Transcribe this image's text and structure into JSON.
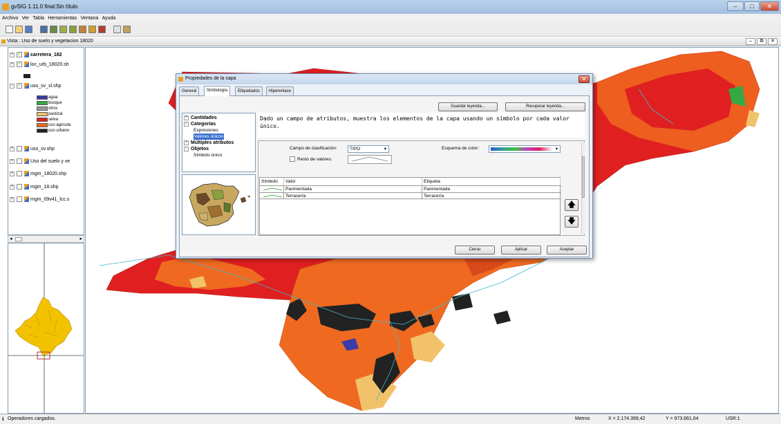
{
  "app": {
    "title": "gvSIG 1.11.0 final:Sin título",
    "win_minimize": "–",
    "win_maximize": "□",
    "win_close": "✕"
  },
  "menu": [
    "Archivo",
    "Ver",
    "Tabla",
    "Herramientas",
    "Ventana",
    "Ayuda"
  ],
  "view": {
    "title": "Vista : Uso de suelo y vegetacion 18020"
  },
  "toc": {
    "layers": [
      {
        "name": "carretera_182",
        "checked": true,
        "bold": true
      },
      {
        "name": "loc_urb_18020.sh",
        "checked": true
      },
      {
        "name": "uso_sv_sl.shp",
        "checked": true
      },
      {
        "name": "uso_sv.shp",
        "checked": false
      },
      {
        "name": "Uso del suelo y ve",
        "checked": false
      },
      {
        "name": "mgm_18020.shp",
        "checked": false
      },
      {
        "name": "mgm_18.shp",
        "checked": false
      },
      {
        "name": "mgm_09v41_lcc.s",
        "checked": false
      }
    ],
    "legend": [
      {
        "label": "agua",
        "color": "#3a3aa8"
      },
      {
        "label": "bosque",
        "color": "#33aa44"
      },
      {
        "label": "otros",
        "color": "#999999"
      },
      {
        "label": "pastizal",
        "color": "#f2c26a"
      },
      {
        "label": "selva",
        "color": "#e02020"
      },
      {
        "label": "uso agricola",
        "color": "#ef6a20"
      },
      {
        "label": "uso urbano",
        "color": "#222222"
      }
    ]
  },
  "dialog": {
    "title": "Propiedades de la capa",
    "tabs": [
      "General",
      "Simbología",
      "Etiquetados",
      "Hiperenlace"
    ],
    "active_tab": "Simbología",
    "save_legend": "Guardar leyenda...",
    "load_legend": "Recuperar leyenda...",
    "tree": {
      "cantidades": "Cantidades",
      "categorias": "Categorías",
      "expresiones": "Expresiones",
      "valores_unicos": "Valores únicos",
      "multiples": "Múltiples atributos",
      "objetos": "Objetos",
      "simbolo_unico": "Símbolo único"
    },
    "description": "Dado un campo de atributos, muestra los elementos de la capa usando un símbolo por cada valor único.",
    "field_label": "Campo de clasificación:",
    "field_value": "TIPO",
    "scheme_label": "Esquema de color:",
    "rest_label": "Resto de valores:",
    "table": {
      "headers": [
        "Símbolo",
        "Valor",
        "Etiqueta"
      ],
      "rows": [
        {
          "valor": "Pavimentada",
          "etiqueta": "Pavimentada"
        },
        {
          "valor": "Terracería",
          "etiqueta": "Terracería"
        }
      ]
    },
    "up": "🡅",
    "down": "🡇",
    "cerrar": "Cerrar",
    "aplicar": "Aplicar",
    "aceptar": "Aceptar"
  },
  "status": {
    "message": "Operadores cargados.",
    "units": "Metros",
    "x": "X = 2.174.399,42",
    "y": "Y = 973.661,64",
    "crs": "USR:1"
  },
  "colors": {
    "selva": "#e02020",
    "uso_agricola": "#ef6a20",
    "pastizal": "#f2c26a",
    "urbano": "#222222",
    "bosque": "#33aa44",
    "agua": "#3a3aa8"
  }
}
